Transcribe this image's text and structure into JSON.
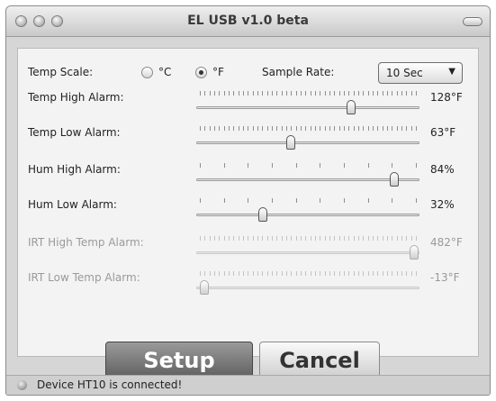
{
  "window": {
    "title": "EL USB v1.0 beta"
  },
  "temp_scale": {
    "label": "Temp Scale:",
    "options": [
      "°C",
      "°F"
    ],
    "selected": "°F"
  },
  "sample_rate": {
    "label": "Sample Rate:",
    "value": "10 Sec"
  },
  "sliders": [
    {
      "label": "Temp High Alarm:",
      "value_text": "128°F",
      "position": 0.7,
      "enabled": true,
      "ticks": 46
    },
    {
      "label": "Temp Low Alarm:",
      "value_text": "63°F",
      "position": 0.42,
      "enabled": true,
      "ticks": 46
    },
    {
      "label": "Hum High Alarm:",
      "value_text": "84%",
      "position": 0.9,
      "enabled": true,
      "ticks": 10
    },
    {
      "label": "Hum Low Alarm:",
      "value_text": "32%",
      "position": 0.29,
      "enabled": true,
      "ticks": 10
    },
    {
      "label": "IRT High Temp Alarm:",
      "value_text": "482°F",
      "position": 0.99,
      "enabled": false,
      "ticks": 46
    },
    {
      "label": "IRT Low Temp Alarm:",
      "value_text": "-13°F",
      "position": 0.02,
      "enabled": false,
      "ticks": 46
    }
  ],
  "buttons": {
    "setup": "Setup",
    "cancel": "Cancel"
  },
  "status": {
    "text": "Device HT10 is connected!"
  }
}
